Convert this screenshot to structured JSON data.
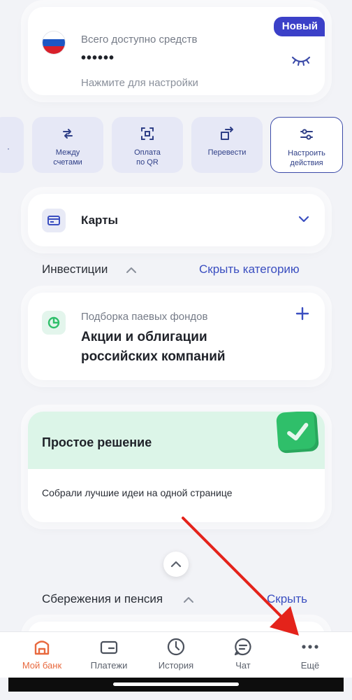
{
  "balance": {
    "badge": "Новый",
    "title": "Всего доступно средств",
    "masked_value": "••••••",
    "hint": "Нажмите для настройки"
  },
  "actions": [
    {
      "label": "Между\nсчетами",
      "icon": "transfer-arrows-icon"
    },
    {
      "label": "Оплата\nпо QR",
      "icon": "qr-scan-icon"
    },
    {
      "label": "Перевести",
      "icon": "send-money-icon"
    },
    {
      "label": "Настроить\nдействия",
      "icon": "settings-sliders-icon"
    }
  ],
  "cards": {
    "label": "Карты",
    "icon": "card-icon"
  },
  "investments": {
    "title": "Инвестиции",
    "hide_link": "Скрыть категорию",
    "card": {
      "subtitle": "Подборка паевых фондов",
      "title_line1": "Акции и облигации",
      "title_line2": "российских компаний"
    }
  },
  "simple": {
    "title": "Простое решение",
    "description": "Собрали лучшие идеи на одной странице"
  },
  "savings": {
    "title": "Сбережения и пенсия",
    "hide_link": "Скрыть"
  },
  "bottom_nav": [
    {
      "label": "Мой банк",
      "icon": "home-icon",
      "active": true
    },
    {
      "label": "Платежи",
      "icon": "wallet-icon",
      "active": false
    },
    {
      "label": "История",
      "icon": "clock-icon",
      "active": false
    },
    {
      "label": "Чат",
      "icon": "chat-icon",
      "active": false
    },
    {
      "label": "Ещё",
      "icon": "more-dots-icon",
      "active": false
    }
  ],
  "colors": {
    "accent": "#3b40c8",
    "link": "#3a4ec0",
    "active_nav": "#e8693e",
    "annotation_arrow": "#e4231b"
  }
}
